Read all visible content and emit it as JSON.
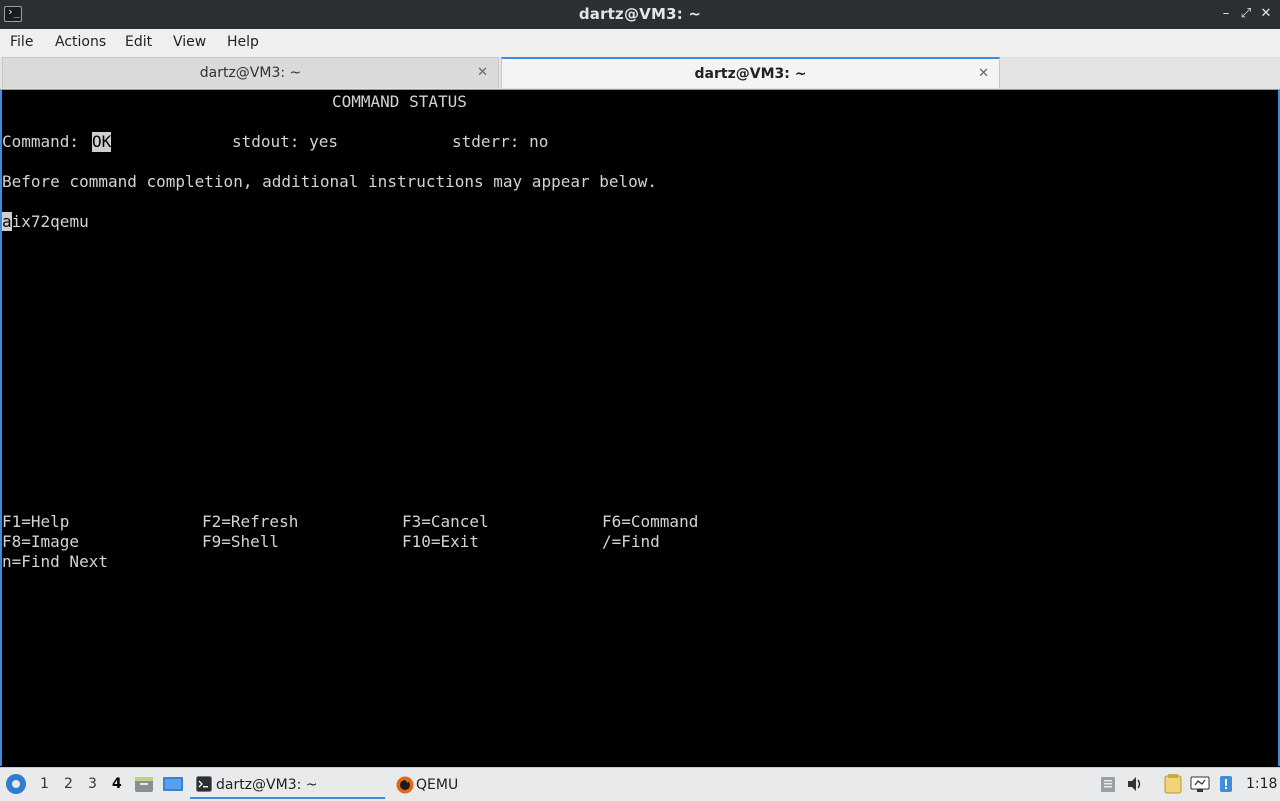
{
  "window": {
    "title": "dartz@VM3: ~"
  },
  "menubar": {
    "items": [
      "File",
      "Actions",
      "Edit",
      "View",
      "Help"
    ]
  },
  "tabs": [
    {
      "label": "dartz@VM3: ~",
      "active": false
    },
    {
      "label": "dartz@VM3: ~",
      "active": true
    }
  ],
  "terminal": {
    "heading": "COMMAND STATUS",
    "command_label": "Command:",
    "command_value": "OK",
    "stdout": "stdout: yes",
    "stderr": "stderr: no",
    "message": "Before command completion, additional instructions may appear below.",
    "output_first_char": "a",
    "output_rest": "ix72qemu",
    "keys": [
      [
        "F1=Help",
        "F2=Refresh",
        "F3=Cancel",
        "F6=Command"
      ],
      [
        "F8=Image",
        "F9=Shell",
        "F10=Exit",
        "/=Find"
      ],
      [
        "n=Find Next"
      ]
    ]
  },
  "taskbar": {
    "workspaces": [
      "1",
      "2",
      "3",
      "4"
    ],
    "current_workspace": "4",
    "tasks": [
      {
        "label": "dartz@VM3: ~",
        "icon": "terminal-icon",
        "active": true
      },
      {
        "label": "QEMU",
        "icon": "qemu-icon",
        "active": false
      }
    ],
    "clock": "1:18",
    "accent": "#3c8dde"
  }
}
